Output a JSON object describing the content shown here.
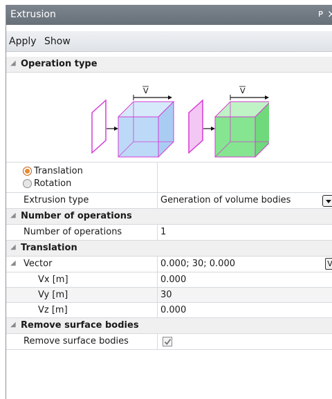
{
  "window": {
    "title": "Extrusion",
    "pin_glyph": "ᴘ",
    "close_glyph": "×"
  },
  "toolbar": {
    "apply_label": "Apply",
    "show_label": "Show"
  },
  "sections": {
    "operation_type": {
      "label": "Operation type",
      "illustration_label_1": "V",
      "illustration_label_2": "V",
      "options": {
        "translation": "Translation",
        "rotation": "Rotation"
      },
      "selected": "Translation",
      "extrusion_type_label": "Extrusion type",
      "extrusion_type_value": "Generation of volume bodies"
    },
    "number_of_operations": {
      "label": "Number of operations",
      "field_label": "Number of operations",
      "value": "1"
    },
    "translation": {
      "label": "Translation",
      "vector_label": "Vector",
      "vector_value": "0.000; 30; 0.000",
      "vector_button": "V",
      "vx_label": "Vx [m]",
      "vx_value": "0.000",
      "vy_label": "Vy [m]",
      "vy_value": "30",
      "vz_label": "Vz [m]",
      "vz_value": "0.000"
    },
    "remove_surface_bodies": {
      "label": "Remove surface bodies",
      "field_label": "Remove surface bodies",
      "checked": true
    }
  },
  "colors": {
    "titlebar": "#6f7780",
    "radio_accent": "#e98a2e",
    "box_blue": "#b9d8f7",
    "box_green": "#7fe38a",
    "face_magenta": "#d63bd6"
  },
  "icons": {
    "collapse": "collapse-triangle-icon",
    "checkbox_check": "check-icon"
  }
}
